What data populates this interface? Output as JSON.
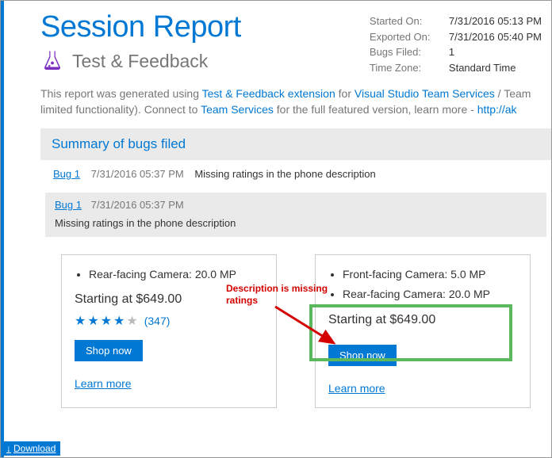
{
  "header": {
    "title": "Session Report",
    "subtitle": "Test & Feedback",
    "meta": {
      "started_label": "Started On:",
      "started_val": "7/31/2016 05:13 PM",
      "exported_label": "Exported On:",
      "exported_val": "7/31/2016 05:40 PM",
      "bugs_label": "Bugs Filed:",
      "bugs_val": "1",
      "tz_label": "Time Zone:",
      "tz_val": "Standard Time"
    }
  },
  "intro": {
    "pre": "This report was generated using ",
    "link1": "Test & Feedback extension",
    "mid1": " for ",
    "link2": "Visual Studio Team Services",
    "mid2": " / Team",
    "line2_pre": "limited functionality). Connect to ",
    "link3": "Team Services",
    "line2_mid": " for the full featured version, learn more - ",
    "link4": "http://ak"
  },
  "section": {
    "summary_title": "Summary of bugs filed"
  },
  "bugs": [
    {
      "link": "Bug 1",
      "time": "7/31/2016 05:37 PM",
      "title": "Missing ratings in the phone description"
    }
  ],
  "detail": {
    "link": "Bug 1",
    "time": "7/31/2016 05:37 PM",
    "title": "Missing ratings in the phone description"
  },
  "screenshot": {
    "left": {
      "spec1": "Rear-facing Camera: 20.0 MP",
      "price": "Starting at $649.00",
      "rating_count": "(347)",
      "shop": "Shop now",
      "learn": "Learn more"
    },
    "right": {
      "spec1": "Front-facing Camera: 5.0 MP",
      "spec2": "Rear-facing Camera: 20.0 MP",
      "price": "Starting at $649.00",
      "shop": "Shop now",
      "learn": "Learn more"
    },
    "annotation": "Description is missing ratings"
  },
  "download": "Download"
}
